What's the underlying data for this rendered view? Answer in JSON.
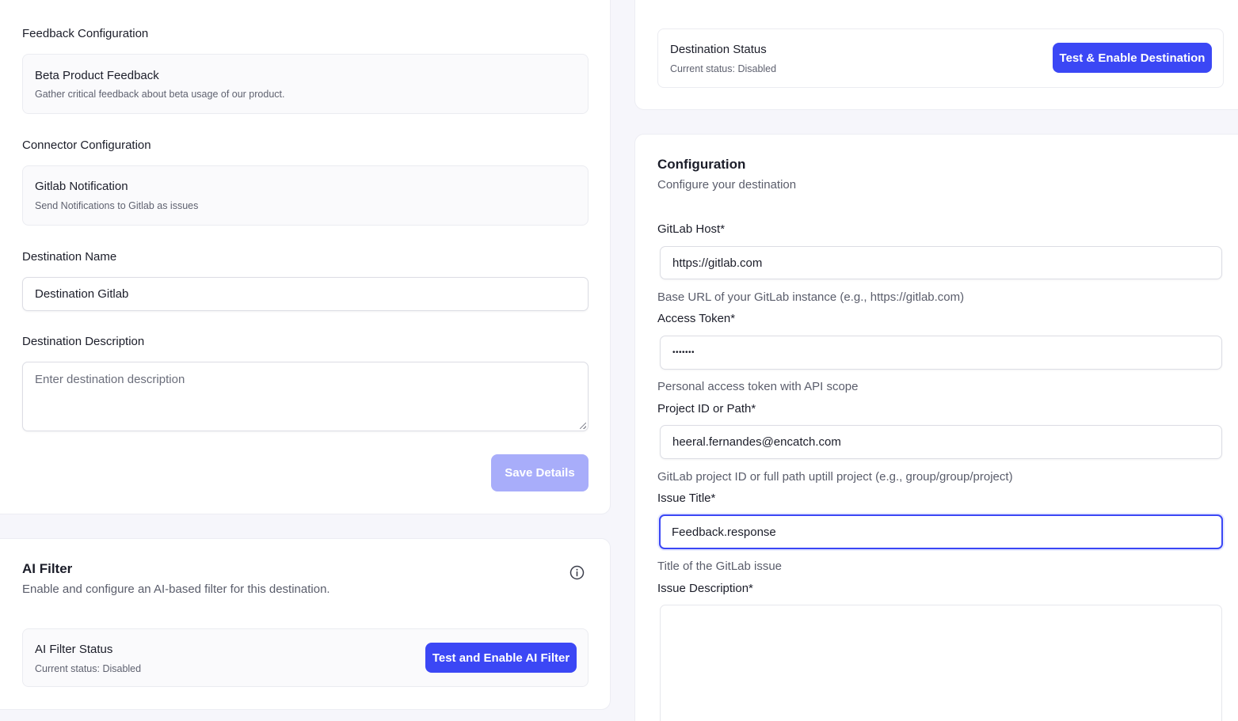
{
  "left": {
    "feedback_config": {
      "label": "Feedback Configuration",
      "title": "Beta Product Feedback",
      "subtitle": "Gather critical feedback about beta usage of our product."
    },
    "connector_config": {
      "label": "Connector Configuration",
      "title": "Gitlab Notification",
      "subtitle": "Send Notifications to Gitlab as issues"
    },
    "destination_name": {
      "label": "Destination Name",
      "value": "Destination Gitlab"
    },
    "destination_description": {
      "label": "Destination Description",
      "placeholder": "Enter destination description"
    },
    "save_button": "Save Details"
  },
  "ai_filter": {
    "title": "AI Filter",
    "subtitle": "Enable and configure an AI-based filter for this destination.",
    "icon": "info-icon",
    "status_title": "AI Filter Status",
    "status_sub": "Current status: Disabled",
    "button": "Test and Enable AI Filter"
  },
  "destination_status": {
    "title": "Destination Status",
    "status_sub": "Current status: Disabled",
    "button": "Test & Enable Destination"
  },
  "configuration": {
    "title": "Configuration",
    "subtitle": "Configure your destination",
    "fields": {
      "host": {
        "label": "GitLab Host*",
        "value": "https://gitlab.com",
        "help": "Base URL of your GitLab instance (e.g., https://gitlab.com)"
      },
      "token": {
        "label": "Access Token*",
        "value": "•••••••",
        "help": "Personal access token with API scope"
      },
      "project": {
        "label": "Project ID or Path*",
        "value": "heeral.fernandes@encatch.com",
        "help": "GitLab project ID or full path uptill project (e.g., group/group/project)"
      },
      "issue_title": {
        "label": "Issue Title*",
        "value": "Feedback.response",
        "help": "Title of the GitLab issue"
      },
      "issue_description": {
        "label": "Issue Description*",
        "value": ""
      }
    }
  },
  "colors": {
    "primary": "#3b47f5",
    "primary_disabled": "#a8adfa",
    "background": "#f6f6fb"
  }
}
